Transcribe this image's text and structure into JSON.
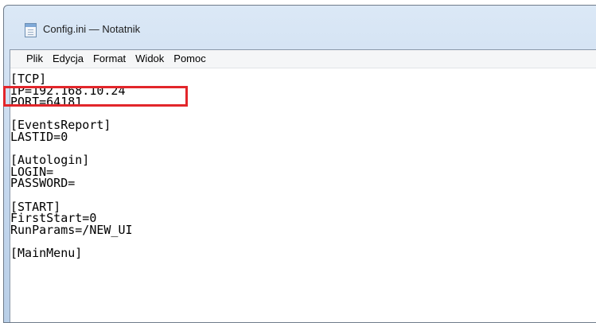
{
  "window": {
    "title": "Config.ini — Notatnik"
  },
  "menu": [
    {
      "label": "Plik"
    },
    {
      "label": "Edycja"
    },
    {
      "label": "Format"
    },
    {
      "label": "Widok"
    },
    {
      "label": "Pomoc"
    }
  ],
  "editor": {
    "lines": [
      "[TCP]",
      "IP=192.168.10.24",
      "PORT=64181",
      "",
      "[EventsReport]",
      "LASTID=0",
      "",
      "[Autologin]",
      "LOGIN=",
      "PASSWORD=",
      "",
      "[START]",
      "FirstStart=0",
      "RunParams=/NEW_UI",
      "",
      "[MainMenu]"
    ]
  },
  "annotation": {
    "highlight_color": "#e2262b"
  }
}
